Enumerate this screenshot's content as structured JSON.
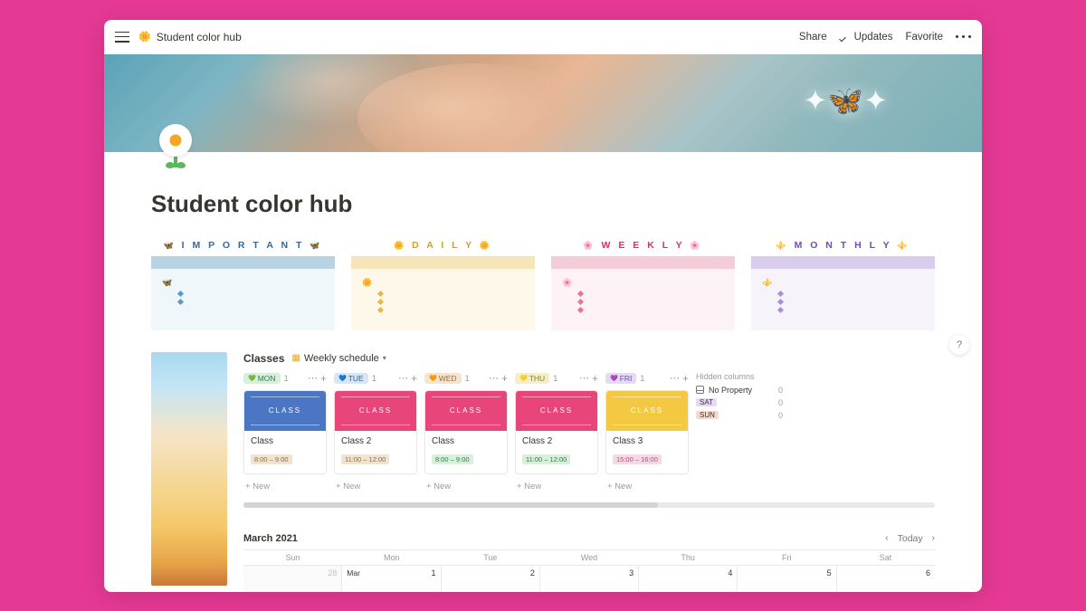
{
  "topbar": {
    "breadcrumb_icon": "🌼",
    "breadcrumb": "Student color hub",
    "share": "Share",
    "updates": "Updates",
    "favorite": "Favorite"
  },
  "page": {
    "title": "Student color hub"
  },
  "categories": {
    "important": {
      "label": "I M P O R T A N T",
      "left_icon": "🦋",
      "right_icon": "🦋",
      "bullet_icon": "🦋"
    },
    "daily": {
      "label": "D A I L Y",
      "left_icon": "🌼",
      "right_icon": "🌼",
      "bullet_icon": "🌼"
    },
    "weekly": {
      "label": "W E E K L Y",
      "left_icon": "🌸",
      "right_icon": "🌸",
      "bullet_icon": "🌸"
    },
    "monthly": {
      "label": "M O N T H L Y",
      "left_icon": "⚜️",
      "right_icon": "⚜️",
      "bullet_icon": "⚜️"
    }
  },
  "classes": {
    "title": "Classes",
    "view_label": "Weekly schedule",
    "new_label": "+  New",
    "columns": [
      {
        "day": "MON",
        "heart": "💚",
        "pill_bg": "#d6f0dc",
        "pill_fg": "#2f7d4a",
        "count": "1",
        "card_title": "Class",
        "cover_bg": "#4a76c4",
        "time": "8:00 – 9:00",
        "time_bg": "#f0e4d0",
        "time_fg": "#8a6d3b"
      },
      {
        "day": "TUE",
        "heart": "💙",
        "pill_bg": "#d6e6f5",
        "pill_fg": "#2f5f9e",
        "count": "1",
        "card_title": "Class 2",
        "cover_bg": "#e8457a",
        "time": "11:00 – 12:00",
        "time_bg": "#f0e4d0",
        "time_fg": "#8a6d3b"
      },
      {
        "day": "WED",
        "heart": "🧡",
        "pill_bg": "#f5e4d0",
        "pill_fg": "#a86b2e",
        "count": "1",
        "card_title": "Class",
        "cover_bg": "#e8457a",
        "time": "8:00 – 9:00",
        "time_bg": "#d6f0dc",
        "time_fg": "#2f7d4a"
      },
      {
        "day": "THU",
        "heart": "💛",
        "pill_bg": "#f5efc8",
        "pill_fg": "#8a7a2e",
        "count": "1",
        "card_title": "Class 2",
        "cover_bg": "#e8457a",
        "time": "11:00 – 12:00",
        "time_bg": "#d6f0dc",
        "time_fg": "#2f7d4a"
      },
      {
        "day": "FRI",
        "heart": "💜",
        "pill_bg": "#e6d9f5",
        "pill_fg": "#6b4aa8",
        "count": "1",
        "card_title": "Class 3",
        "cover_bg": "#f5c842",
        "time": "15:00 – 16:00",
        "time_bg": "#f5d9e4",
        "time_fg": "#b34d7a"
      }
    ],
    "cover_text": "CLASS",
    "hidden": {
      "title": "Hidden columns",
      "noprop": "No Property",
      "noprop_count": "0",
      "sat": "SAT",
      "sat_bg": "#e6d9f5",
      "sat_count": "0",
      "sun": "SUN",
      "sun_bg": "#f5d9d0",
      "sun_count": "0"
    }
  },
  "calendar": {
    "title": "March 2021",
    "today": "Today",
    "days": [
      "Sun",
      "Mon",
      "Tue",
      "Wed",
      "Thu",
      "Fri",
      "Sat"
    ],
    "row1": [
      "28",
      "Mar 1",
      "2",
      "3",
      "4",
      "5",
      "6"
    ]
  },
  "help": {
    "symbol": "?"
  }
}
